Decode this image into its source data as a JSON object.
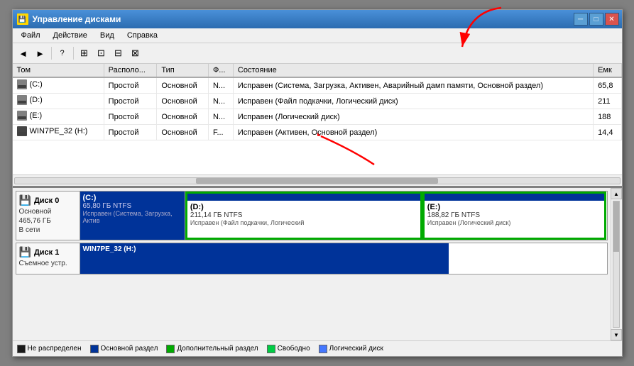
{
  "window": {
    "title": "Управление дисками",
    "title_icon": "💾"
  },
  "menu": {
    "items": [
      "Файл",
      "Действие",
      "Вид",
      "Справка"
    ]
  },
  "toolbar": {
    "buttons": [
      "←",
      "→",
      "⊡",
      "❓",
      "⊞",
      "⊟",
      "⊠",
      "⊡"
    ]
  },
  "table": {
    "columns": [
      "Том",
      "Располо...",
      "Тип",
      "Ф...",
      "Состояние",
      "Емк"
    ],
    "rows": [
      {
        "name": "(C:)",
        "location": "Простой",
        "type": "Основной",
        "fs": "N...",
        "status": "Исправен (Система, Загрузка, Активен, Аварийный дамп памяти, Основной раздел)",
        "size": "65,8"
      },
      {
        "name": "(D:)",
        "location": "Простой",
        "type": "Основной",
        "fs": "N...",
        "status": "Исправен (Файл подкачки, Логический диск)",
        "size": "211"
      },
      {
        "name": "(E:)",
        "location": "Простой",
        "type": "Основной",
        "fs": "N...",
        "status": "Исправен (Логический диск)",
        "size": "188"
      },
      {
        "name": "WIN7PE_32 (H:)",
        "location": "Простой",
        "type": "Основной",
        "fs": "F...",
        "status": "Исправен (Активен, Основной раздел)",
        "size": "14,4"
      }
    ]
  },
  "disks": [
    {
      "label": "Диск 0",
      "type": "Основной",
      "size": "465,76 ГБ",
      "status": "В сети",
      "partitions": [
        {
          "name": "(C:)",
          "size": "65,80 ГБ NTFS",
          "status": "Исправен (Система, Загрузка, Актив",
          "type": "normal",
          "width": "20%"
        },
        {
          "name": "(D:)",
          "size": "211,14 ГБ NTFS",
          "status": "Исправен (Файл подкачки, Логический",
          "type": "selected",
          "width": "45%"
        },
        {
          "name": "(E:)",
          "size": "188,82 ГБ NTFS",
          "status": "Исправен (Логический диск)",
          "type": "selected",
          "width": "35%"
        }
      ]
    },
    {
      "label": "Диск 1",
      "type": "Съемное устр.",
      "size": "",
      "status": "",
      "partitions": [
        {
          "name": "WIN7PE_32 (H:)",
          "size": "",
          "status": "",
          "type": "blue",
          "width": "70%"
        }
      ]
    }
  ],
  "legend": [
    {
      "color": "#1a1a1a",
      "label": "Не распределен"
    },
    {
      "color": "#003399",
      "label": "Основной раздел"
    },
    {
      "color": "#00aa00",
      "label": "Дополнительный раздел"
    },
    {
      "color": "#00cc44",
      "label": "Свободно"
    },
    {
      "color": "#4477ff",
      "label": "Логический диск"
    }
  ]
}
